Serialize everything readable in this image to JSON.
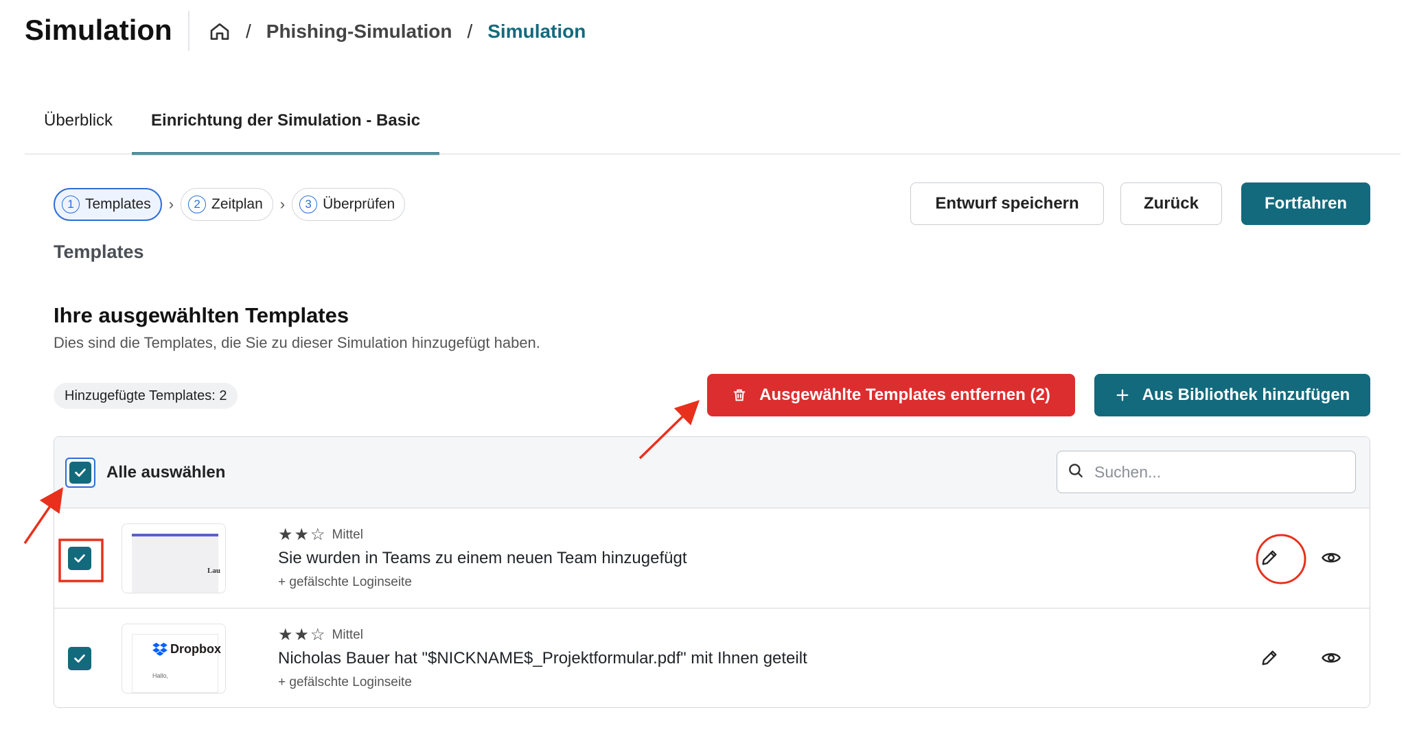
{
  "header": {
    "title": "Simulation",
    "breadcrumb": {
      "home_icon": "home-icon",
      "items": [
        "Phishing-Simulation",
        "Simulation"
      ],
      "separator": "/"
    }
  },
  "tabs": [
    {
      "label": "Überblick",
      "active": false
    },
    {
      "label": "Einrichtung der Simulation - Basic",
      "active": true
    }
  ],
  "stepper": [
    {
      "num": "1",
      "label": "Templates",
      "active": true
    },
    {
      "num": "2",
      "label": "Zeitplan",
      "active": false
    },
    {
      "num": "3",
      "label": "Überprüfen",
      "active": false
    }
  ],
  "actions": {
    "save_draft": "Entwurf speichern",
    "back": "Zurück",
    "continue": "Fortfahren"
  },
  "section": {
    "label": "Templates",
    "heading": "Ihre ausgewählten Templates",
    "description": "Dies sind die Templates, die Sie zu dieser Simulation hinzugefügt haben.",
    "count_badge": "Hinzugefügte Templates: 2",
    "remove_button": "Ausgewählte Templates entfernen (2)",
    "add_button": "Aus Bibliothek hinzufügen"
  },
  "table": {
    "select_all_label": "Alle auswählen",
    "search_placeholder": "Suchen...",
    "rows": [
      {
        "difficulty": "Mittel",
        "stars_filled": 2,
        "stars_total": 3,
        "title": "Sie wurden in Teams zu einem neuen Team hinzugefügt",
        "subtitle": "+ gefälschte Loginseite",
        "thumb_text": "Lau",
        "checked": true
      },
      {
        "difficulty": "Mittel",
        "stars_filled": 2,
        "stars_total": 3,
        "title": "Nicholas Bauer hat \"$NICKNAME$_Projektformular.pdf\" mit Ihnen geteilt",
        "subtitle": "+ gefälschte Loginseite",
        "thumb_brand": "Dropbox",
        "thumb_text": "Hallo,",
        "checked": true
      }
    ]
  },
  "colors": {
    "primary": "#136a7c",
    "danger": "#dc2e2e",
    "annotation": "#e8301c",
    "step_active": "#2b6fd6"
  }
}
